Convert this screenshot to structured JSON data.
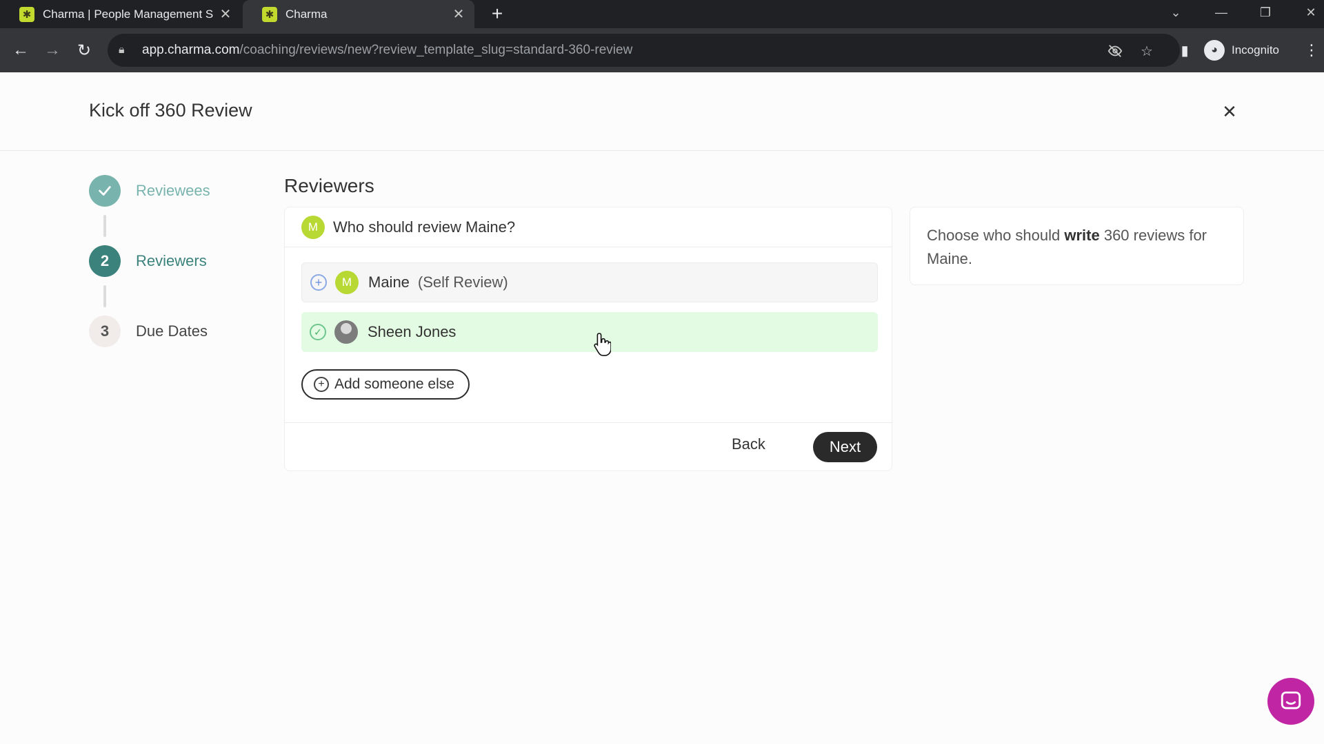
{
  "browser": {
    "tabs": [
      {
        "title": "Charma | People Management S",
        "favicon": "charma-logo-icon"
      },
      {
        "title": "Charma",
        "favicon": "charma-logo-icon"
      }
    ],
    "url_host": "app.charma.com",
    "url_path": "/coaching/reviews/new?review_template_slug=standard-360-review",
    "incognito_label": "Incognito"
  },
  "header": {
    "title": "Kick off 360 Review"
  },
  "steps": [
    {
      "number": "",
      "label": "Reviewees",
      "state": "done"
    },
    {
      "number": "2",
      "label": "Reviewers",
      "state": "active"
    },
    {
      "number": "3",
      "label": "Due Dates",
      "state": "todo"
    }
  ],
  "main": {
    "section_title": "Reviewers",
    "question_avatar": "M",
    "question": "Who should review Maine?",
    "reviewers": [
      {
        "avatar": "M",
        "name": "Maine",
        "note": "(Self Review)",
        "selected": false
      },
      {
        "avatar": "photo",
        "name": "Sheen Jones",
        "note": "",
        "selected": true
      }
    ],
    "add_label": "Add someone else",
    "back_label": "Back",
    "next_label": "Next"
  },
  "help": {
    "text_before": "Choose who should ",
    "text_bold": "write",
    "text_after": " 360 reviews for Maine."
  },
  "colors": {
    "accent": "#3b827c",
    "done": "#78b4ad",
    "avatar": "#b8d834",
    "selected_row": "#e2fbe2",
    "chat": "#c026a4"
  }
}
